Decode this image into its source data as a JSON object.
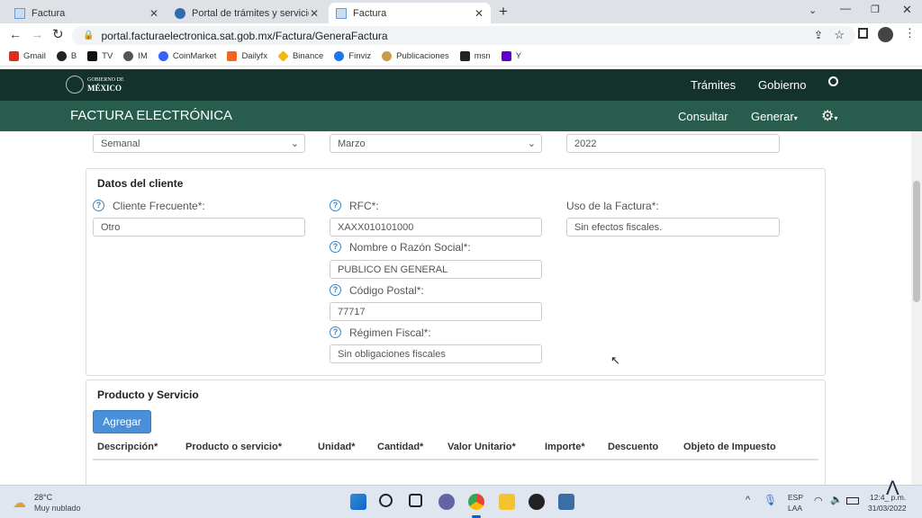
{
  "tabs": [
    {
      "title": "Factura"
    },
    {
      "title": "Portal de trámites y servicios - SAT"
    },
    {
      "title": "Factura"
    }
  ],
  "address": "portal.facturaelectronica.sat.gob.mx/Factura/GeneraFactura",
  "bookmarks": [
    "Gmail",
    "B",
    "TV",
    "IM",
    "CoinMarket",
    "Dailyfx",
    "Binance",
    "Finviz",
    "Publicaciones",
    "msn",
    "Y"
  ],
  "gob": {
    "logo_top": "GOBIERNO DE",
    "logo_bottom": "MÉXICO",
    "nav1": "Trámites",
    "nav2": "Gobierno"
  },
  "sub": {
    "title": "FACTURA ELECTRÓNICA",
    "consultar": "Consultar",
    "generar": "Generar"
  },
  "period": {
    "periodicidad": "Semanal",
    "mes": "Marzo",
    "anio": "2022"
  },
  "cliente": {
    "heading": "Datos del cliente",
    "frecuente_label": "Cliente Frecuente*:",
    "frecuente_value": "Otro",
    "rfc_label": "RFC*:",
    "rfc_value": "XAXX010101000",
    "uso_label": "Uso de la Factura*:",
    "uso_value": "Sin efectos fiscales.",
    "nombre_label": "Nombre o Razón Social*:",
    "nombre_value": "PUBLICO EN GENERAL",
    "cp_label": "Código Postal*:",
    "cp_value": "77717",
    "regimen_label": "Régimen Fiscal*:",
    "regimen_value": "Sin obligaciones fiscales"
  },
  "producto": {
    "heading": "Producto y Servicio",
    "agregar": "Agregar",
    "columns": [
      "Descripción*",
      "Producto o servicio*",
      "Unidad*",
      "Cantidad*",
      "Valor Unitario*",
      "Importe*",
      "Descuento",
      "Objeto de Impuesto"
    ]
  },
  "taskbar": {
    "temp": "28°C",
    "weather": "Muy nublado",
    "lang1": "ESP",
    "lang2": "LAA",
    "time": "12:4_ p.m.",
    "date": "31/03/2022"
  }
}
